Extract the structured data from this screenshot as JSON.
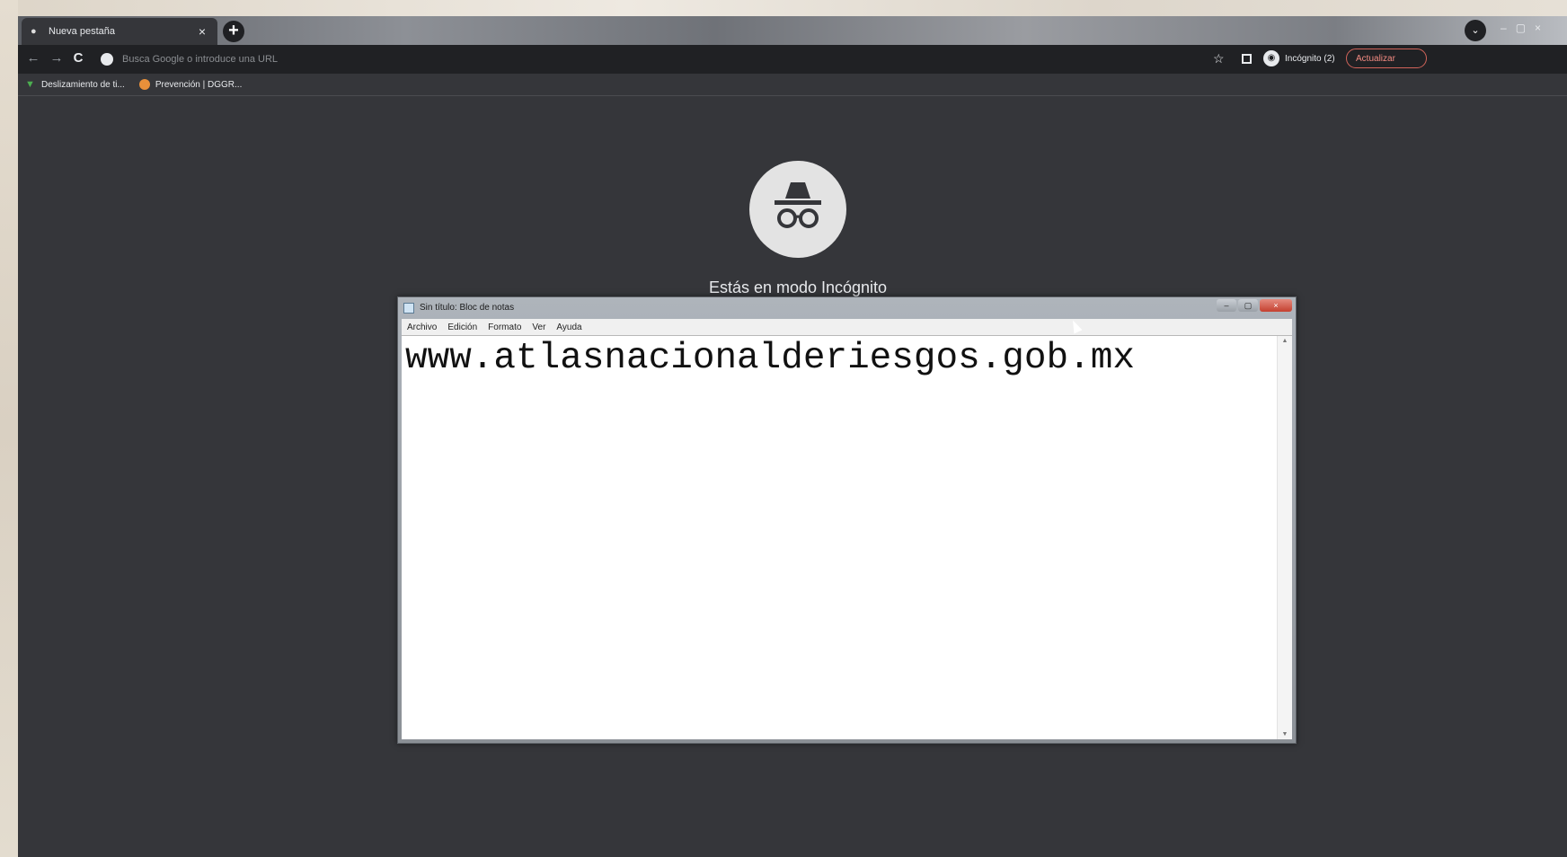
{
  "browser": {
    "tab": {
      "title": "Nueva pestaña",
      "close": "×"
    },
    "newtab": "+",
    "window_controls": [
      "–",
      "▢",
      "×"
    ],
    "nav": {
      "back": "←",
      "forward": "→",
      "reload": "C"
    },
    "omnibox": {
      "placeholder": "Busca Google o introduce una URL"
    },
    "profile": {
      "label": "Incógnito (2)"
    },
    "update_button": "Actualizar",
    "bookmarks": [
      {
        "label": "Deslizamiento de ti..."
      },
      {
        "label": "Prevención | DGGR..."
      }
    ]
  },
  "ntp": {
    "heading": "Estás en modo Incógnito"
  },
  "notepad": {
    "title": "Sin título: Bloc de notas",
    "menu": [
      "Archivo",
      "Edición",
      "Formato",
      "Ver",
      "Ayuda"
    ],
    "content": "www.atlasnacionalderiesgos.gob.mx",
    "controls": {
      "minimize": "–",
      "maximize": "▢",
      "close": "×"
    }
  },
  "colors": {
    "ntp_background": "#35363a",
    "toolbar": "#202124",
    "update_accent": "#f28b82"
  }
}
